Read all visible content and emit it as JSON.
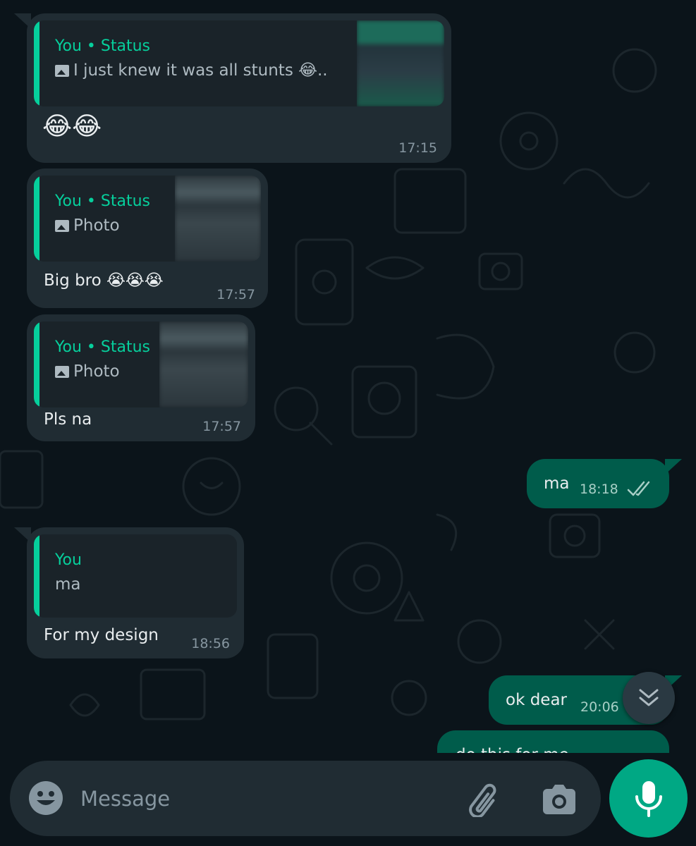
{
  "colors": {
    "background": "#0b141a",
    "incoming_bubble": "#202c33",
    "outgoing_bubble": "#005c4b",
    "accent": "#06cf9c",
    "mic_button": "#00a884"
  },
  "messages": [
    {
      "direction": "incoming",
      "quote": {
        "sender": "You • Status",
        "text": "I just knew it was all stunts 😂..",
        "type_icon": "image-icon"
      },
      "text": "😂😂",
      "time": "17:15"
    },
    {
      "direction": "incoming",
      "quote": {
        "sender": "You • Status",
        "text": "Photo",
        "type_icon": "image-icon"
      },
      "text": "Big bro 😭😭😭",
      "time": "17:57"
    },
    {
      "direction": "incoming",
      "quote": {
        "sender": "You • Status",
        "text": "Photo",
        "type_icon": "image-icon"
      },
      "text": "Pls na",
      "time": "17:57"
    },
    {
      "direction": "outgoing",
      "text": "ma",
      "time": "18:18",
      "status_icon": "double-check-icon"
    },
    {
      "direction": "incoming",
      "quote": {
        "sender": "You",
        "text": "ma"
      },
      "text": "For my design",
      "time": "18:56"
    },
    {
      "direction": "outgoing",
      "text": "ok dear",
      "time": "20:06"
    },
    {
      "direction": "outgoing",
      "text": "do this for me",
      "partially_visible": true
    }
  ],
  "composer": {
    "placeholder": "Message",
    "emoji_icon": "emoji-icon",
    "attach_icon": "paperclip-icon",
    "camera_icon": "camera-icon"
  },
  "mic_icon": "microphone-icon",
  "scroll_icon": "double-chevron-down-icon"
}
